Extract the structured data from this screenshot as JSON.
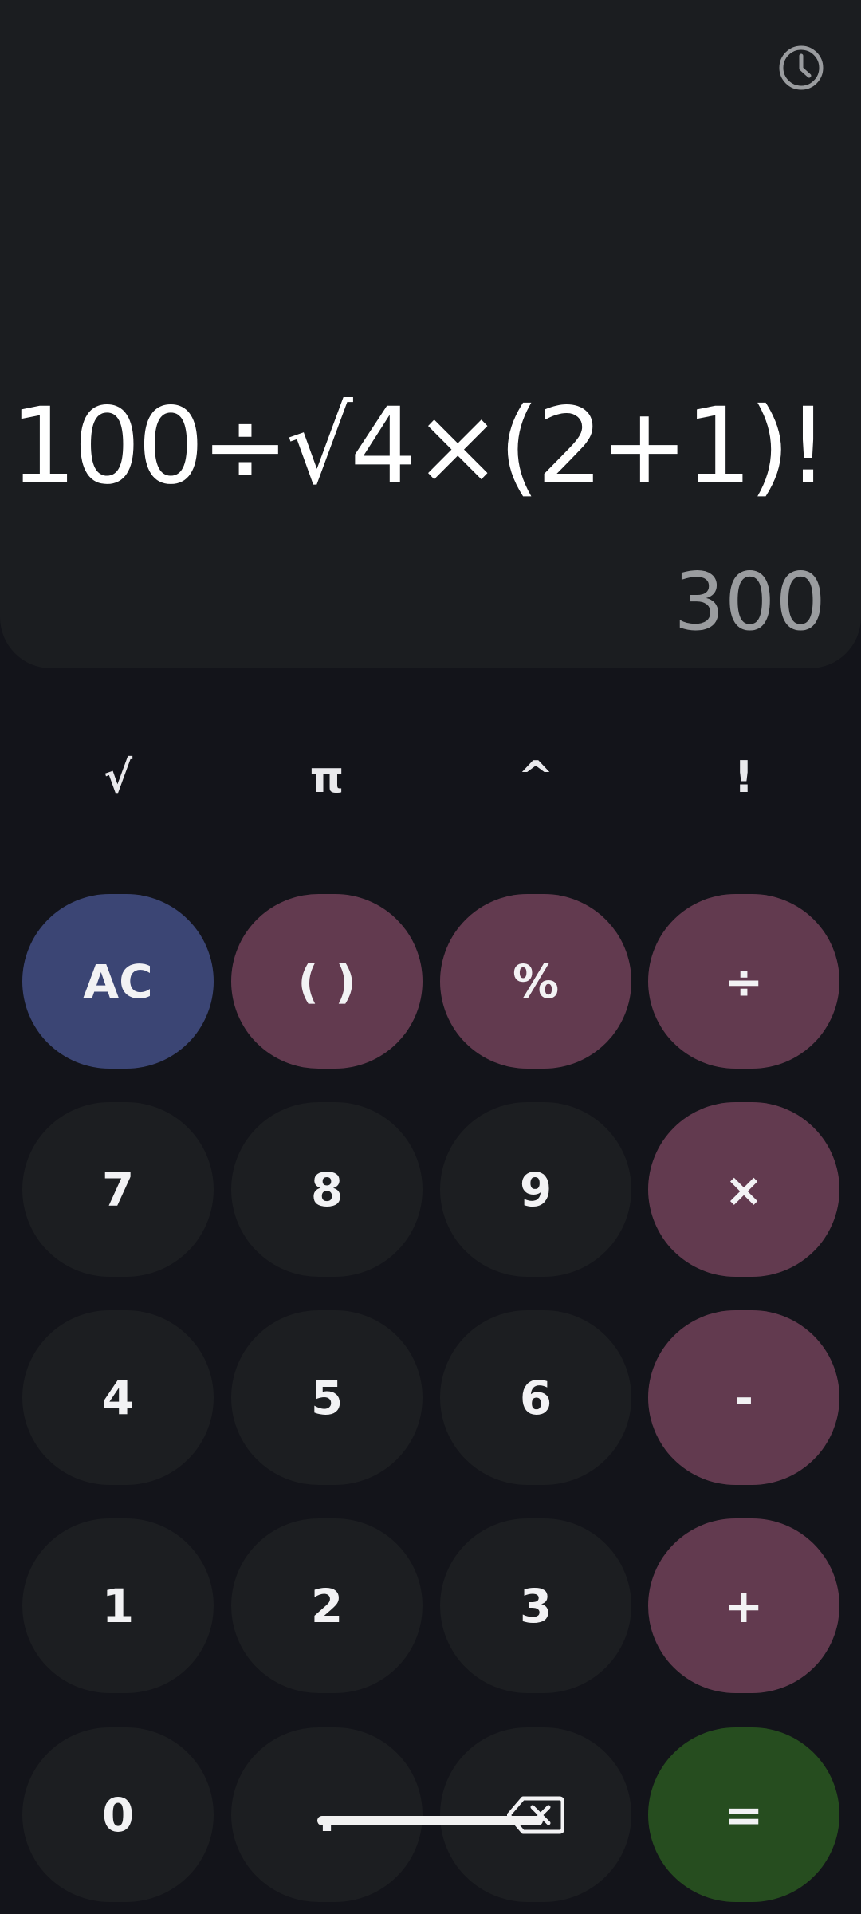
{
  "display": {
    "history_icon": "clock-history-icon",
    "expression": "100÷√4×(2+1)!",
    "result": "300"
  },
  "scientific": {
    "keys": [
      {
        "label": "√",
        "name": "sqrt-button"
      },
      {
        "label": "π",
        "name": "pi-button"
      },
      {
        "label": "^",
        "name": "power-button"
      },
      {
        "label": "!",
        "name": "factorial-button"
      }
    ]
  },
  "keypad": {
    "rows": [
      [
        {
          "label": "AC",
          "type": "clear"
        },
        {
          "label": "( )",
          "type": "op"
        },
        {
          "label": "%",
          "type": "op"
        },
        {
          "label": "÷",
          "type": "op"
        }
      ],
      [
        {
          "label": "7",
          "type": "num"
        },
        {
          "label": "8",
          "type": "num"
        },
        {
          "label": "9",
          "type": "num"
        },
        {
          "label": "×",
          "type": "op"
        }
      ],
      [
        {
          "label": "4",
          "type": "num"
        },
        {
          "label": "5",
          "type": "num"
        },
        {
          "label": "6",
          "type": "num"
        },
        {
          "label": "-",
          "type": "op"
        }
      ],
      [
        {
          "label": "1",
          "type": "num"
        },
        {
          "label": "2",
          "type": "num"
        },
        {
          "label": "3",
          "type": "num"
        },
        {
          "label": "+",
          "type": "op"
        }
      ],
      [
        {
          "label": "0",
          "type": "num"
        },
        {
          "label": ".",
          "type": "num"
        },
        {
          "label": "",
          "type": "num",
          "icon": "backspace-icon"
        },
        {
          "label": "=",
          "type": "equals"
        }
      ]
    ]
  },
  "colors": {
    "background": "#13141a",
    "display_panel": "#1b1d20",
    "number_key": "#1c1e21",
    "operator_key": "#623a4f",
    "clear_key": "#3b4574",
    "equals_key": "#264d1f",
    "result_text": "#9a9c9f"
  }
}
